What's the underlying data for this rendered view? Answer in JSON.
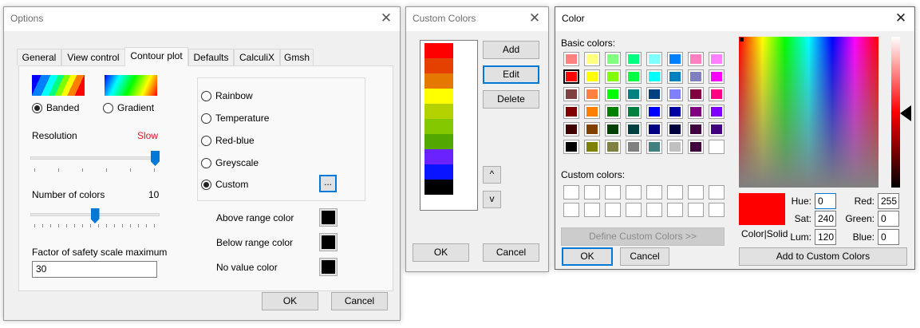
{
  "options": {
    "title": "Options",
    "tabs": [
      "General",
      "View control",
      "Contour plot",
      "Defaults",
      "CalculiX",
      "Gmsh"
    ],
    "active_tab": "Contour plot",
    "banded_label": "Banded",
    "gradient_label": "Gradient",
    "resolution_label": "Resolution",
    "resolution_value": "Slow",
    "resolution_value_color": "#e81123",
    "resolution_level": 1.0,
    "num_colors_label": "Number of colors",
    "num_colors_value": "10",
    "num_colors_level": 0.5,
    "factor_label": "Factor of safety scale maximum",
    "factor_value": "30",
    "schemes": [
      "Rainbow",
      "Temperature",
      "Red-blue",
      "Greyscale",
      "Custom"
    ],
    "selected_scheme": "Custom",
    "custom_browse": "...",
    "above_label": "Above range color",
    "below_label": "Below range color",
    "novalue_label": "No value color",
    "above_color": "#000000",
    "below_color": "#000000",
    "novalue_color": "#000000",
    "ok": "OK",
    "cancel": "Cancel"
  },
  "custom_colors": {
    "title": "Custom Colors",
    "colors": [
      "#ff0000",
      "#e44000",
      "#e47800",
      "#ffff00",
      "#b4d200",
      "#84c800",
      "#52a800",
      "#6a22ff",
      "#0a14ff",
      "#000000"
    ],
    "add": "Add",
    "edit": "Edit",
    "delete": "Delete",
    "up": "^",
    "down": "v",
    "ok": "OK",
    "cancel": "Cancel"
  },
  "color_dialog": {
    "title": "Color",
    "basic_label": "Basic colors:",
    "basic_colors": [
      [
        "#ff8080",
        "#ffff80",
        "#80ff80",
        "#00ff80",
        "#80ffff",
        "#0080ff",
        "#ff80c0",
        "#ff80ff"
      ],
      [
        "#ff0000",
        "#ffff00",
        "#80ff00",
        "#00ff40",
        "#00ffff",
        "#0080c0",
        "#8080c0",
        "#ff00ff"
      ],
      [
        "#804040",
        "#ff8040",
        "#00ff00",
        "#008080",
        "#004080",
        "#8080ff",
        "#800040",
        "#ff0080"
      ],
      [
        "#800000",
        "#ff8000",
        "#008000",
        "#008040",
        "#0000ff",
        "#0000a0",
        "#800080",
        "#8000ff"
      ],
      [
        "#400000",
        "#804000",
        "#004000",
        "#004040",
        "#000080",
        "#000040",
        "#400040",
        "#400080"
      ],
      [
        "#000000",
        "#808000",
        "#808040",
        "#808080",
        "#408080",
        "#c0c0c0",
        "#400040",
        "#ffffff"
      ]
    ],
    "selected_basic": "#ff0000",
    "custom_label": "Custom colors:",
    "define_btn": "Define Custom Colors >>",
    "ok": "OK",
    "cancel": "Cancel",
    "preview_label": "Color|Solid",
    "preview_color": "#ff0000",
    "hue_label": "Hue:",
    "hue": "0",
    "sat_label": "Sat:",
    "sat": "240",
    "lum_label": "Lum:",
    "lum": "120",
    "red_label": "Red:",
    "red": "255",
    "green_label": "Green:",
    "green": "0",
    "blue_label": "Blue:",
    "blue": "0",
    "add_custom": "Add to Custom Colors"
  },
  "icons": {
    "close": "close-icon",
    "lum_marker": "triangle-left-icon"
  }
}
